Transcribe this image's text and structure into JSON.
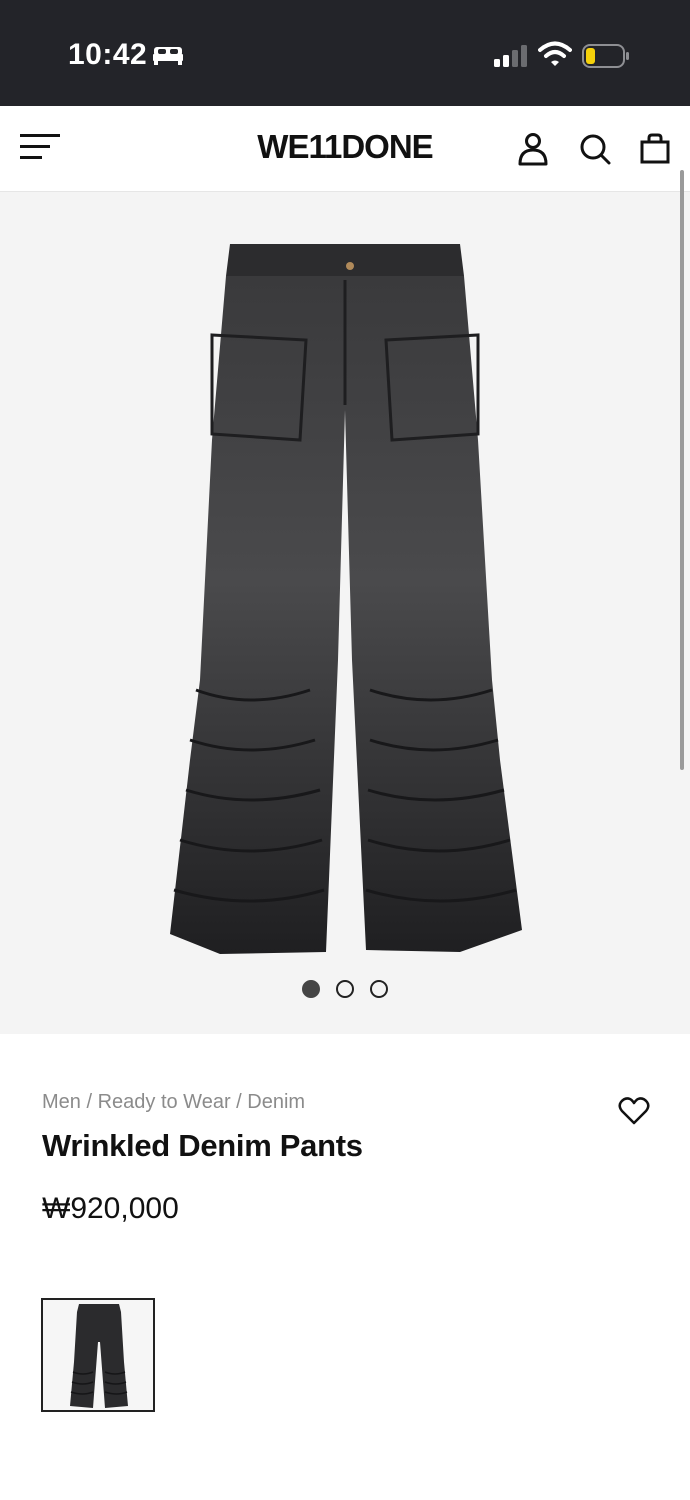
{
  "status_bar": {
    "time": "10:42",
    "icons": [
      "sleep-icon",
      "signal-icon",
      "wifi-icon",
      "battery-icon"
    ]
  },
  "header": {
    "brand": "WE11DONE",
    "icons": [
      "menu-icon",
      "account-icon",
      "search-icon",
      "bag-icon"
    ]
  },
  "gallery": {
    "image_count": 3,
    "active_index": 0
  },
  "product": {
    "breadcrumb": "Men / Ready to Wear / Denim",
    "title": "Wrinkled Denim Pants",
    "price": "₩920,000"
  },
  "colors": {
    "status_bar_bg": "#232429",
    "gallery_bg": "#f4f4f4",
    "battery_level": "#f5d10b",
    "denim": "#2a2a2c"
  }
}
